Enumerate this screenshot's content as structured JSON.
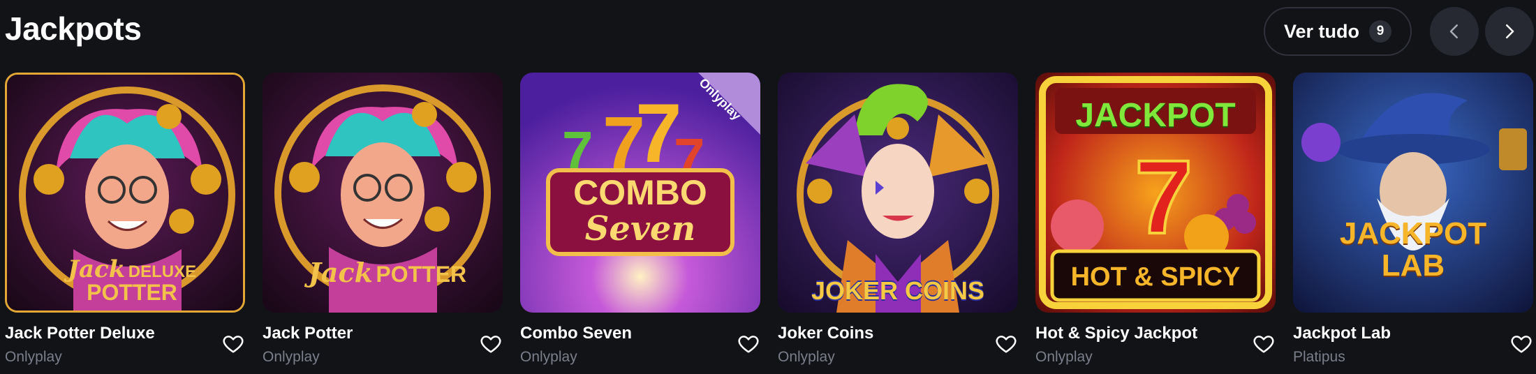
{
  "section": {
    "title": "Jackpots",
    "see_all_label": "Ver tudo",
    "see_all_count": "9"
  },
  "games": [
    {
      "name": "Jack Potter Deluxe",
      "provider": "Onlyplay",
      "art_title_1": "Jack",
      "art_title_2": "DELUXE",
      "art_title_3": "POTTER"
    },
    {
      "name": "Jack Potter",
      "provider": "Onlyplay",
      "art_title_1": "Jack",
      "art_title_2": "POTTER"
    },
    {
      "name": "Combo Seven",
      "provider": "Onlyplay",
      "art_title_1": "COMBO",
      "art_title_2": "Seven",
      "ribbon": "Onlyplay"
    },
    {
      "name": "Joker Coins",
      "provider": "Onlyplay",
      "art_title_1": "JOKER COINS"
    },
    {
      "name": "Hot & Spicy Jackpot",
      "provider": "Onlyplay",
      "art_title_1": "JACKPOT",
      "art_title_2": "HOT & SPICY"
    },
    {
      "name": "Jackpot Lab",
      "provider": "Platipus",
      "art_title_1": "JACKPOT",
      "art_title_2": "LAB"
    }
  ],
  "colors": {
    "background": "#121317",
    "button_border": "#2f323b",
    "nav_button": "#262932",
    "muted_text": "#7b7f8a"
  },
  "icons": {
    "prev": "chevron-left-icon",
    "next": "chevron-right-icon",
    "favorite": "heart-outline-icon"
  }
}
